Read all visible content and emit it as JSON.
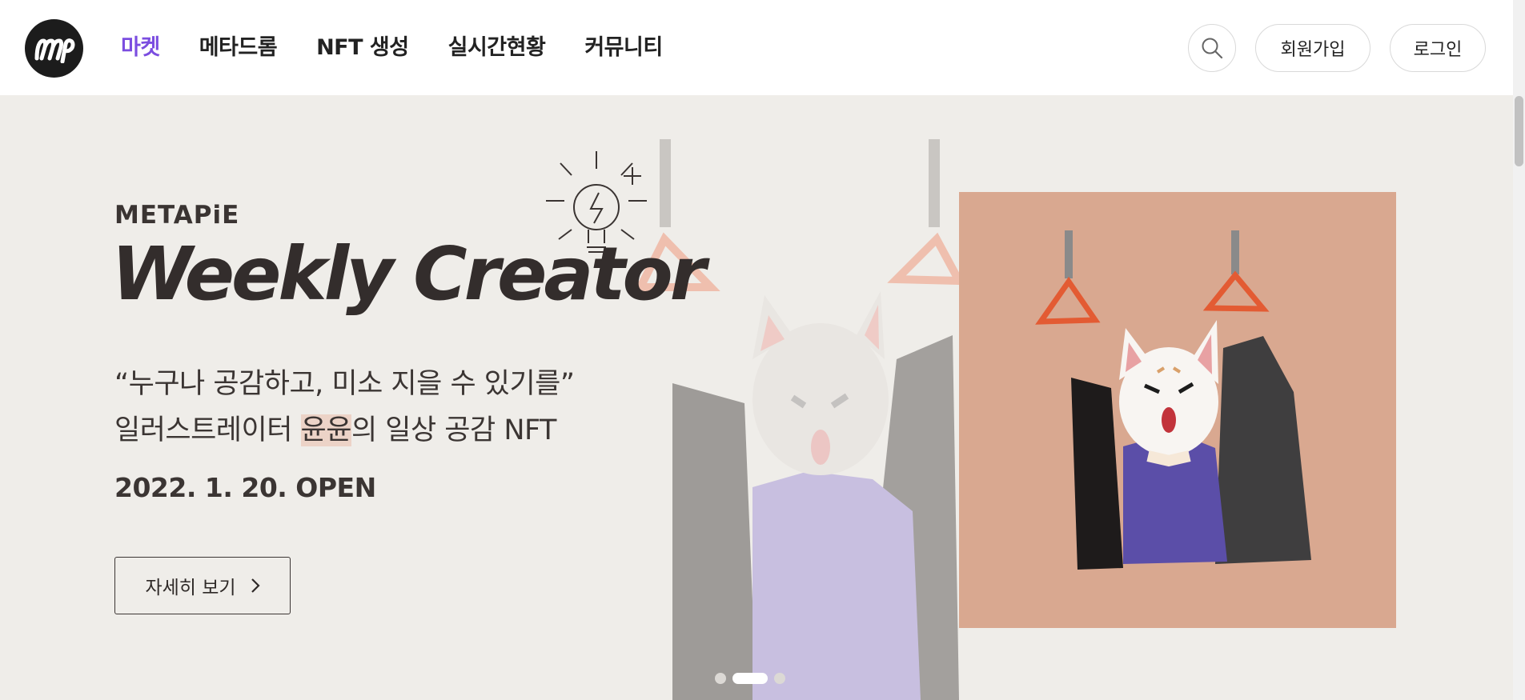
{
  "header": {
    "logo_alt": "mp",
    "nav": [
      {
        "label": "마켓",
        "active": true
      },
      {
        "label": "메타드롬",
        "active": false
      },
      {
        "label": "NFT 생성",
        "active": false
      },
      {
        "label": "실시간현황",
        "active": false
      },
      {
        "label": "커뮤니티",
        "active": false
      }
    ],
    "signup_label": "회원가입",
    "login_label": "로그인"
  },
  "hero": {
    "brand": "METAPiE",
    "headline": "Weekly Creator",
    "quote": "“누구나 공감하고, 미소 지을 수 있기를”",
    "line2_prefix": "일러스트레이터 ",
    "line2_highlight": "윤윤",
    "line2_suffix": "의 일상 공감 NFT",
    "date": "2022. 1. 20. OPEN",
    "detail_button": "자세히 보기",
    "slides": 3,
    "active_slide": 2
  },
  "colors": {
    "accent": "#7b4de0",
    "hero_bg": "#efede9",
    "card_bg": "#d9a890"
  }
}
